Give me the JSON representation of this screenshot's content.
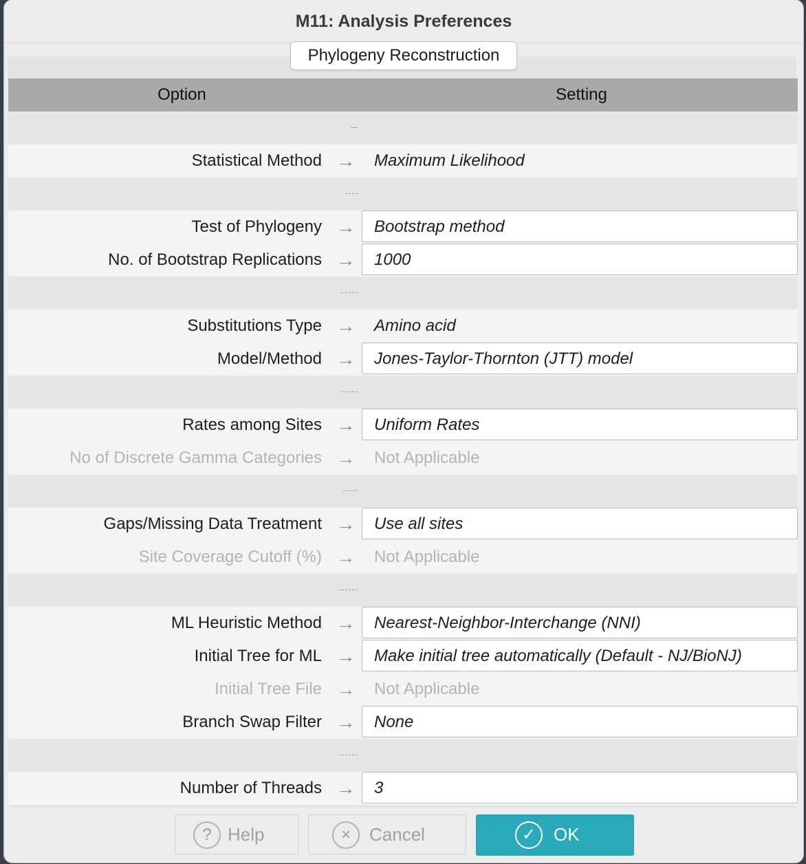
{
  "window": {
    "title": "M11: Analysis Preferences"
  },
  "tab": {
    "label": "Phylogeny Reconstruction"
  },
  "table": {
    "header": {
      "option": "Option",
      "setting": "Setting"
    },
    "arrow": "→",
    "rows": [
      {
        "label": "Statistical Method",
        "value": "Maximum Likelihood"
      },
      {
        "label": "Test of Phylogeny",
        "value": "Bootstrap method"
      },
      {
        "label": "No. of Bootstrap Replications",
        "value": "1000"
      },
      {
        "label": "Substitutions Type",
        "value": "Amino acid"
      },
      {
        "label": "Model/Method",
        "value": "Jones-Taylor-Thornton (JTT) model"
      },
      {
        "label": "Rates among Sites",
        "value": "Uniform Rates"
      },
      {
        "label": "No of Discrete Gamma Categories",
        "value": "Not Applicable"
      },
      {
        "label": "Gaps/Missing Data Treatment",
        "value": "Use all sites"
      },
      {
        "label": "Site Coverage Cutoff (%)",
        "value": "Not Applicable"
      },
      {
        "label": "ML Heuristic Method",
        "value": "Nearest-Neighbor-Interchange (NNI)"
      },
      {
        "label": "Initial Tree for ML",
        "value": "Make initial tree automatically (Default - NJ/BioNJ)"
      },
      {
        "label": "Initial Tree File",
        "value": "Not Applicable"
      },
      {
        "label": "Branch Swap Filter",
        "value": "None"
      },
      {
        "label": "Number of Threads",
        "value": "3"
      }
    ]
  },
  "buttons": {
    "help": {
      "label": "Help",
      "icon": "?"
    },
    "cancel": {
      "label": "Cancel",
      "icon": "×"
    },
    "ok": {
      "label": "OK",
      "icon": "✓"
    }
  },
  "colors": {
    "header_bg": "#a9a9a9",
    "ok_button": "#29a9b9"
  }
}
